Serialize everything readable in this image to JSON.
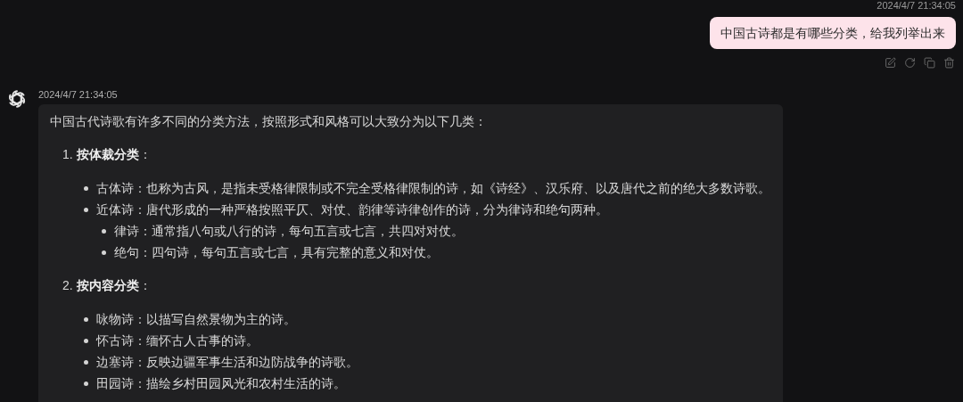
{
  "user_message": {
    "timestamp": "2024/4/7 21:34:05",
    "text": "中国古诗都是有哪些分类，给我列举出来",
    "actions": [
      {
        "kind": "edit"
      },
      {
        "kind": "regenerate"
      },
      {
        "kind": "copy"
      },
      {
        "kind": "delete"
      }
    ]
  },
  "assistant_message": {
    "timestamp": "2024/4/7 21:34:05",
    "intro": "中国古代诗歌有许多不同的分类方法，按照形式和风格可以大致分为以下几类：",
    "sections": [
      {
        "number": "1.",
        "title": "按体裁分类",
        "colon": "：",
        "items": [
          {
            "text": "古体诗：也称为古风，是指未受格律限制或不完全受格律限制的诗，如《诗经》、汉乐府、以及唐代之前的绝大多数诗歌。"
          },
          {
            "text": "近体诗：唐代形成的一种严格按照平仄、对仗、韵律等诗律创作的诗，分为律诗和绝句两种。",
            "children": [
              {
                "text": "律诗：通常指八句或八行的诗，每句五言或七言，共四对对仗。"
              },
              {
                "text": "绝句：四句诗，每句五言或七言，具有完整的意义和对仗。"
              }
            ]
          }
        ]
      },
      {
        "number": "2.",
        "title": "按内容分类",
        "colon": "：",
        "items": [
          {
            "text": "咏物诗：以描写自然景物为主的诗。"
          },
          {
            "text": "怀古诗：缅怀古人古事的诗。"
          },
          {
            "text": "边塞诗：反映边疆军事生活和边防战争的诗歌。"
          },
          {
            "text": "田园诗：描绘乡村田园风光和农村生活的诗。"
          }
        ]
      }
    ]
  }
}
